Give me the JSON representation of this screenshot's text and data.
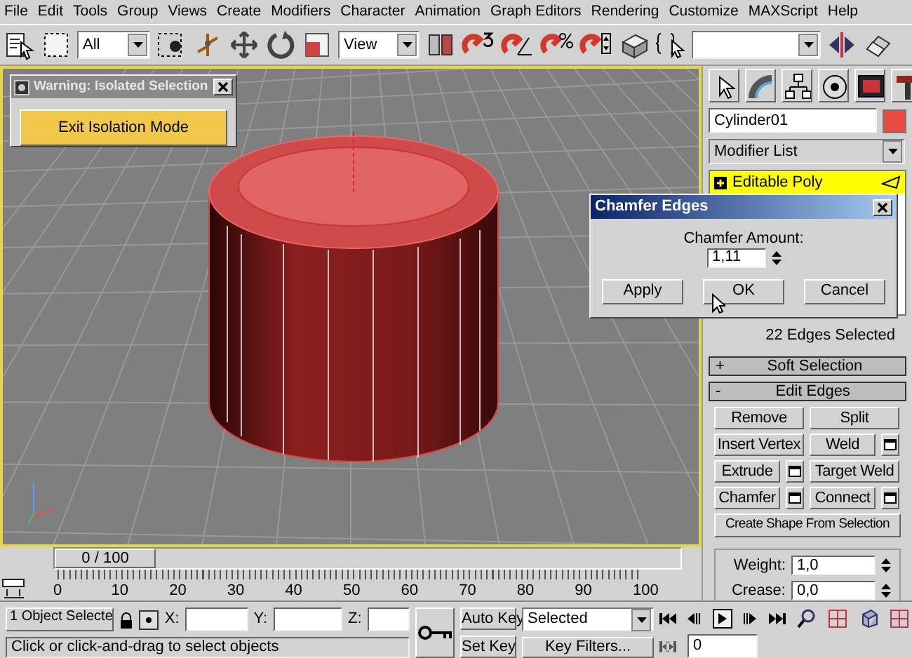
{
  "menu_bar": [
    "File",
    "Edit",
    "Tools",
    "Group",
    "Views",
    "Create",
    "Modifiers",
    "Character",
    "Animation",
    "Graph Editors",
    "Rendering",
    "Customize",
    "MAXScript",
    "Help"
  ],
  "toolbar": {
    "selection_filter": "All",
    "reference_coordinate_system": "View"
  },
  "isolation_dialog": {
    "title": "Warning: Isolated Selection",
    "button": "Exit Isolation Mode"
  },
  "command_panel": {
    "object_name": "Cylinder01",
    "modifier_list": "Modifier List",
    "modifier_stack": [
      {
        "label": "Editable Poly",
        "selected": true
      }
    ],
    "selection_info": "22 Edges Selected",
    "rollouts": [
      {
        "sign": "+",
        "title": "Soft Selection"
      },
      {
        "sign": "-",
        "title": "Edit Edges"
      }
    ],
    "edit_edges_buttons": [
      {
        "label": "Remove",
        "settings": false
      },
      {
        "label": "Split",
        "settings": false
      },
      {
        "label": "Insert Vertex",
        "settings": false
      },
      {
        "label": "Weld",
        "settings": true
      },
      {
        "label": "Extrude",
        "settings": true
      },
      {
        "label": "Target Weld",
        "settings": false
      },
      {
        "label": "Chamfer",
        "settings": true
      },
      {
        "label": "Connect",
        "settings": true
      }
    ],
    "wide_button": "Create Shape From Selection",
    "spinners": [
      {
        "label": "Weight:",
        "value": "1,0"
      },
      {
        "label": "Crease:",
        "value": "0,0"
      }
    ]
  },
  "chamfer_dialog": {
    "title": "Chamfer Edges",
    "label": "Chamfer Amount:",
    "value": "1,11",
    "buttons": [
      "Apply",
      "OK",
      "Cancel"
    ]
  },
  "time_slider": {
    "label": "0 / 100",
    "level": 0
  },
  "ruler_labels": [
    "0",
    "10",
    "20",
    "30",
    "40",
    "50",
    "60",
    "70",
    "80",
    "90",
    "100"
  ],
  "status_bar": {
    "selection_count": "1 Object Selecte",
    "x_label": "X:",
    "y_label": "Y:",
    "z_label": "Z:",
    "prompt": "Click or click-and-drag to select objects",
    "auto_key": "Auto Key",
    "set_key": "Set Key",
    "key_mode": "Selected",
    "key_filters": "Key Filters...",
    "current_frame": "0"
  }
}
